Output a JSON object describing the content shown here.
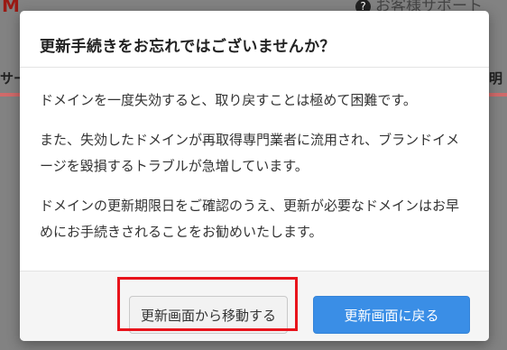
{
  "background_page": {
    "logo_text": "M",
    "support_label": "お客様サポート",
    "left_tab_fragment": "サー",
    "right_tab_fragment": "明"
  },
  "dialog": {
    "title": "更新手続きをお忘れではございませんか？",
    "paragraphs": [
      "ドメインを一度失効すると、取り戻すことは極めて困難です。",
      "また、失効したドメインが再取得専門業者に流用され、ブランドイメージを毀損するトラブルが急増しています。",
      "ドメインの更新期限日をご確認のうえ、更新が必要なドメインはお早めにお手続きされることをお勧めいたします。"
    ],
    "buttons": {
      "move_from_update": "更新画面から移動する",
      "back_to_update": "更新画面に戻る"
    }
  },
  "colors": {
    "primary": "#3a8ee6",
    "highlight": "#e8131b",
    "overlay": "#828282"
  }
}
